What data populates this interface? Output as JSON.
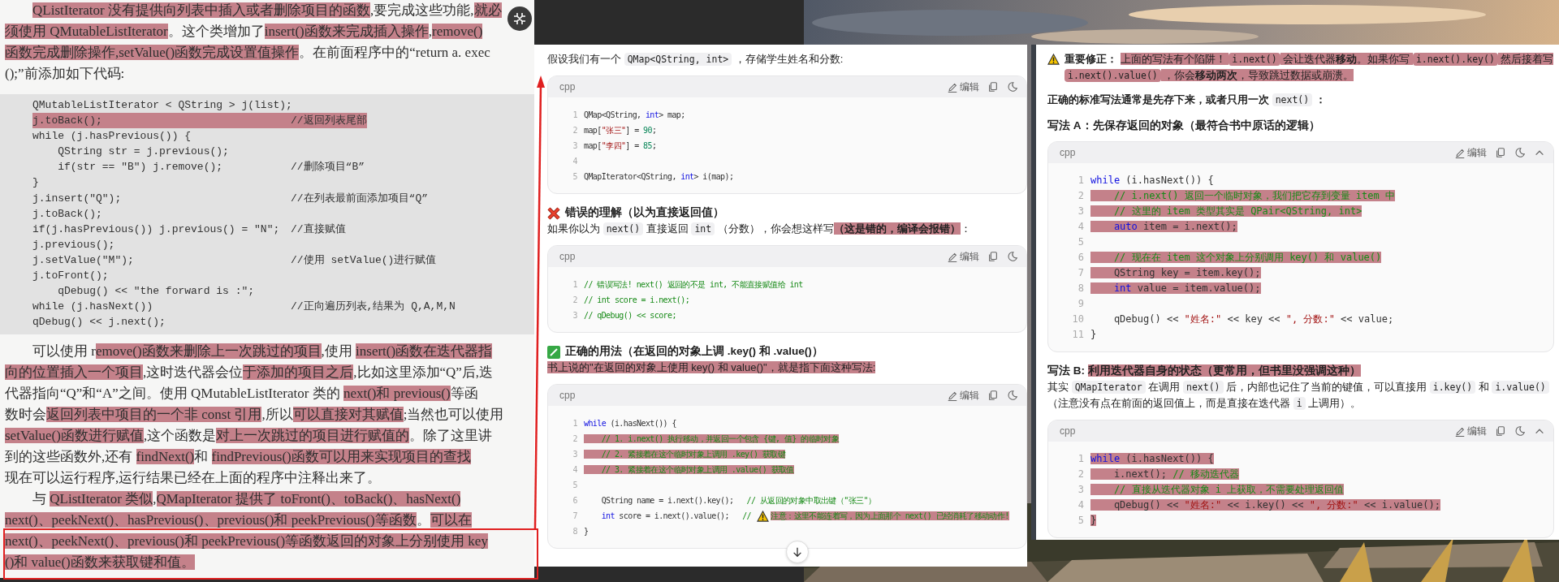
{
  "book": {
    "intro": {
      "lines": [
        [
          {
            "kind": "mark",
            "text": "QListIterator 没有提供向列表中插入或者删除项目的函数"
          },
          ",要完成这些功能,",
          {
            "kind": "mark",
            "text": "就必"
          }
        ],
        [
          {
            "kind": "mark",
            "text": "须使用 QMutableListIterator"
          },
          "。这个类增加了",
          {
            "kind": "mark",
            "text": "insert()函数来完成插入操作"
          },
          ",",
          {
            "kind": "mark",
            "text": "remove()"
          }
        ],
        [
          {
            "kind": "mark",
            "text": "函数完成删除操作,"
          },
          {
            "kind": "mark",
            "text": "setValue()函数完成设置值操作"
          },
          "。在前面程序中的“return a. exec"
        ],
        [
          "();”前添加如下代码:"
        ]
      ]
    },
    "code": [
      {
        "code": "QMutableListIterator < QString > j(list);",
        "marked": false
      },
      {
        "code": "j.toBack();",
        "comment": "//返回列表尾部",
        "marked": true
      },
      {
        "code": "while (j.hasPrevious()) {",
        "marked": false
      },
      {
        "code": "    QString str = j.previous();",
        "marked": false
      },
      {
        "code": "    if(str == \"B\") j.remove();",
        "comment": "//删除项目“B”",
        "marked": false
      },
      {
        "code": "}",
        "marked": false
      },
      {
        "code": "j.insert(\"Q\");",
        "comment": "//在列表最前面添加项目“Q”",
        "marked": false
      },
      {
        "code": "j.toBack();",
        "marked": false
      },
      {
        "code": "if(j.hasPrevious()) j.previous() = \"N\";",
        "comment": "//直接赋值",
        "marked": false
      },
      {
        "code": "j.previous();",
        "marked": false
      },
      {
        "code": "j.setValue(\"M\");",
        "comment": "//使用 setValue()进行赋值",
        "marked": false
      },
      {
        "code": "j.toFront();",
        "marked": false
      },
      {
        "code": "    qDebug() << \"the forward is :\";",
        "marked": false
      },
      {
        "code": "while (j.hasNext())",
        "comment": "//正向遍历列表,结果为 Q,A,M,N",
        "marked": false
      },
      {
        "code": "qDebug() << j.next();",
        "marked": false
      }
    ],
    "paragraphs": [
      {
        "lines": [
          [
            "可以使用 r",
            {
              "kind": "mark",
              "text": "emove()函数来删除上一次跳过的项目"
            },
            ",使用 ",
            {
              "kind": "mark",
              "text": "insert()函数在迭代器指"
            }
          ],
          [
            {
              "kind": "mark",
              "text": "向的位置插入一个项目"
            },
            ",这时迭代器会位",
            {
              "kind": "mark",
              "text": "于添加的项目之后"
            },
            ",比如这里添加“Q”后,迭"
          ],
          [
            "代器指向“Q”和“A”之间。使用 QMutableListIterator 类的 ",
            {
              "kind": "mark",
              "text": "next()和 previous()"
            },
            "等函"
          ],
          [
            "数时会",
            {
              "kind": "mark",
              "text": "返回列表中项目的一个非 const 引用"
            },
            ",所以",
            {
              "kind": "mark",
              "text": "可以直接对其赋值"
            },
            ";当然也可以使用"
          ],
          [
            {
              "kind": "mark",
              "text": "setValue()函数进行赋值"
            },
            ",这个函数是",
            {
              "kind": "mark",
              "text": "对上一次跳过的项目进行赋值的"
            },
            "。除了这里讲"
          ],
          [
            "到的这些函数外,还有 ",
            {
              "kind": "mark",
              "text": "findNext()"
            },
            "和 ",
            {
              "kind": "mark",
              "text": "findPrevious()函数可以用来实现项目的查找"
            }
          ],
          [
            "现在可以运行程序,运行结果已经在上面的程序中注释出来了。"
          ]
        ]
      },
      {
        "lines": [
          [
            "与 ",
            {
              "kind": "mark",
              "text": "QListIterator 类似"
            },
            ",",
            {
              "kind": "mark",
              "text": "QMapIterator 提供了 toFront()、toBack()、hasNext()"
            }
          ],
          [
            {
              "kind": "mark",
              "text": "next()、peekNext()、hasPrevious()、previous()和 peekPrevious()等函数"
            },
            "。",
            {
              "kind": "mark",
              "text": "可以在"
            }
          ],
          [
            {
              "kind": "mark",
              "text": "next()、peekNext()、previous()和 peekPrevious()等函数返回的对象上分别使用 key"
            }
          ],
          [
            {
              "kind": "mark",
              "text": "()和 value()函数来获取键和值。"
            }
          ]
        ]
      }
    ]
  },
  "middle": {
    "blocks": [
      {
        "kind": "para",
        "text": [
          "假设我们有一个 ",
          {
            "kind": "code",
            "text": "QMap<QString, int>"
          },
          " ，存储学生姓名和分数:"
        ]
      },
      {
        "kind": "code",
        "lang": "cpp",
        "edit": "编辑",
        "collapsible": false,
        "lines": [
          {
            "n": "1",
            "code": [
              "QMap<QString, ",
              {
                "kind": "kw",
                "text": "int"
              },
              "> map;"
            ]
          },
          {
            "n": "2",
            "code": [
              "map[",
              {
                "kind": "str",
                "text": "\"张三\""
              },
              "] = ",
              {
                "kind": "num",
                "text": "90"
              },
              ";"
            ]
          },
          {
            "n": "3",
            "code": [
              "map[",
              {
                "kind": "str",
                "text": "\"李四\""
              },
              "] = ",
              {
                "kind": "num",
                "text": "85"
              },
              ";"
            ]
          },
          {
            "n": "4"
          },
          {
            "n": "5",
            "code": [
              "QMapIterator<QString, ",
              {
                "kind": "kw",
                "text": "int"
              },
              "> i(map);"
            ]
          }
        ]
      },
      {
        "kind": "wrongheading",
        "text": [
          "错误的理解（以为直接返回值）"
        ]
      },
      {
        "kind": "para",
        "text": [
          "如果你以为 ",
          {
            "kind": "code",
            "text": "next()"
          },
          " 直接返回 ",
          {
            "kind": "code",
            "text": "int"
          },
          " （分数），你会想这样写",
          {
            "kind": "markbold",
            "text": "（这是错的，编译会报错）"
          },
          "："
        ]
      },
      {
        "kind": "code",
        "lang": "cpp",
        "edit": "编辑",
        "collapsible": false,
        "lines": [
          {
            "n": "1",
            "code": [
              {
                "kind": "com",
                "text": "// 错误写法! next() 返回的不是 int, 不能直接赋值给 int"
              }
            ]
          },
          {
            "n": "2",
            "code": [
              {
                "kind": "com",
                "text": "// int score = i.next();"
              }
            ]
          },
          {
            "n": "3",
            "code": [
              {
                "kind": "com",
                "text": "// qDebug() << score;"
              }
            ]
          }
        ]
      },
      {
        "kind": "rightheading",
        "text": [
          "正确的用法（在返回的对象上调 .key() 和 .value()）"
        ]
      },
      {
        "kind": "para",
        "text": [
          {
            "kind": "mark",
            "text": "书上说的\"在返回的对象上使用 key() 和 value()\"，就是指下面这种写法:"
          }
        ]
      },
      {
        "kind": "code",
        "lang": "cpp",
        "edit": "编辑",
        "collapsible": false,
        "lines": [
          {
            "n": "1",
            "code": [
              {
                "kind": "kw",
                "text": "while"
              },
              " (i.hasNext()) {"
            ]
          },
          {
            "n": "2",
            "code": [
              {
                "kind": "markcom",
                "text": "    // 1. i.next() 执行移动，并返回一个包含 {键, 值} 的临时对象"
              }
            ]
          },
          {
            "n": "3",
            "code": [
              {
                "kind": "markcom",
                "text": "    // 2. 紧接着在这个临时对象上调用 .key() 获取键"
              }
            ]
          },
          {
            "n": "4",
            "code": [
              {
                "kind": "markcom",
                "text": "    // 3. 紧接着在这个临时对象上调用 .value() 获取值"
              }
            ]
          },
          {
            "n": "5"
          },
          {
            "n": "6",
            "code": [
              "    QString name = i.next().key();   ",
              {
                "kind": "com",
                "text": "// 从返回的对象中取出键（\"张三\"）"
              }
            ]
          },
          {
            "n": "7",
            "code": [
              {
                "kind": "kw",
                "text": "    int"
              },
              " score = i.next().value();   ",
              {
                "kind": "com",
                "text": "// "
              },
              {
                "kind": "warning"
              },
              {
                "kind": "markcom",
                "text": "注意：这里不能连着写，因为上面那个 next() 已经消耗了移动动作!"
              }
            ]
          },
          {
            "n": "8",
            "code": [
              "}"
            ]
          }
        ]
      }
    ]
  },
  "right": {
    "blocks": [
      {
        "kind": "warnpara",
        "text": [
          {
            "kind": "bold",
            "text": "重要修正： "
          },
          {
            "kind": "mark",
            "text": "上面的写法有个陷阱！ "
          },
          {
            "kind": "markcode",
            "text": "i.next()"
          },
          {
            "kind": "mark",
            "text": " 会让迭代器"
          },
          {
            "kind": "markbold",
            "text": "移动"
          },
          {
            "kind": "mark",
            "text": "。如果你写 "
          },
          {
            "kind": "markcode",
            "text": "i.next().key()"
          },
          {
            "kind": "mark",
            "text": " 然后接着写 "
          },
          {
            "kind": "markcode",
            "text": "i.next().value()"
          },
          {
            "kind": "mark",
            "text": " ，你会"
          },
          {
            "kind": "markbold",
            "text": "移动两次"
          },
          {
            "kind": "mark",
            "text": "，导致跳过数据或崩溃。"
          }
        ]
      },
      {
        "kind": "para",
        "text": [
          {
            "kind": "bold",
            "text": "正确的标准写法通常是先存下来，或者只用一次 "
          },
          {
            "kind": "code",
            "text": "next()"
          },
          {
            "kind": "bold",
            "text": " ："
          }
        ]
      },
      {
        "kind": "heading",
        "text": [
          "写法 A：先保存返回的对象（最符合书中原话的逻辑）"
        ]
      },
      {
        "kind": "code",
        "lang": "cpp",
        "edit": "编辑",
        "collapsible": true,
        "lines": [
          {
            "n": "1",
            "code": [
              {
                "kind": "kw",
                "text": "while"
              },
              " (i.hasNext()) {"
            ]
          },
          {
            "n": "2",
            "code": [
              {
                "kind": "markcom",
                "text": "    // i.next() 返回一个临时对象，我们把它存到变量 item 中"
              }
            ]
          },
          {
            "n": "3",
            "code": [
              {
                "kind": "markcom",
                "text": "    // 这里的 item 类型其实是 QPair<QString, int>"
              }
            ]
          },
          {
            "n": "4",
            "code": [
              {
                "kind": "markkw",
                "text": "    auto"
              },
              {
                "kind": "mark",
                "text": " item = i.next();"
              }
            ]
          },
          {
            "n": "5"
          },
          {
            "n": "6",
            "code": [
              {
                "kind": "markcom",
                "text": "    // 现在在 item 这个对象上分别调用 key() 和 value()"
              }
            ]
          },
          {
            "n": "7",
            "code": [
              {
                "kind": "mark",
                "text": "    QString key = item.key();"
              }
            ]
          },
          {
            "n": "8",
            "code": [
              {
                "kind": "markkw",
                "text": "    int"
              },
              {
                "kind": "mark",
                "text": " value = item.value();"
              }
            ]
          },
          {
            "n": "9"
          },
          {
            "n": "10",
            "code": [
              "    qDebug() << ",
              {
                "kind": "str",
                "text": "\"姓名:\""
              },
              " << key << ",
              {
                "kind": "str",
                "text": "\", 分数:\""
              },
              " << value;"
            ]
          },
          {
            "n": "11",
            "code": [
              "}"
            ]
          }
        ]
      },
      {
        "kind": "heading",
        "text": [
          "写法 B: ",
          {
            "kind": "markbold",
            "text": "利用迭代器自身的状态（更常用，但书里没强调这种）"
          }
        ]
      },
      {
        "kind": "para",
        "text": [
          "其实 ",
          {
            "kind": "code",
            "text": "QMapIterator"
          },
          " 在调用 ",
          {
            "kind": "code",
            "text": "next()"
          },
          " 后，内部也记住了当前的键值，可以直接用 ",
          {
            "kind": "code",
            "text": "i.key()"
          },
          " 和 ",
          {
            "kind": "code",
            "text": "i.value()"
          },
          " （注意没有点在前面的返回值上，而是直接在迭代器 ",
          {
            "kind": "code",
            "text": "i"
          },
          " 上调用）。"
        ]
      },
      {
        "kind": "code",
        "lang": "cpp",
        "edit": "编辑",
        "collapsible": true,
        "lines": [
          {
            "n": "1",
            "code": [
              {
                "kind": "markkw",
                "text": "while"
              },
              {
                "kind": "mark",
                "text": " (i.hasNext()) {"
              }
            ]
          },
          {
            "n": "2",
            "code": [
              {
                "kind": "mark",
                "text": "    i.next(); "
              },
              {
                "kind": "markcom",
                "text": "// 移动迭代器"
              }
            ]
          },
          {
            "n": "3",
            "code": [
              {
                "kind": "markcom",
                "text": "    // 直接从迭代器对象 i 上获取，不需要处理返回值"
              }
            ]
          },
          {
            "n": "4",
            "code": [
              {
                "kind": "mark",
                "text": "    qDebug() << "
              },
              {
                "kind": "markstr",
                "text": "\"姓名:\""
              },
              {
                "kind": "mark",
                "text": " << i.key() << "
              },
              {
                "kind": "markstr",
                "text": "\", 分数:\""
              },
              {
                "kind": "mark",
                "text": " << i.value();"
              }
            ]
          },
          {
            "n": "5",
            "code": [
              {
                "kind": "mark",
                "text": "}"
              }
            ]
          }
        ]
      }
    ]
  }
}
